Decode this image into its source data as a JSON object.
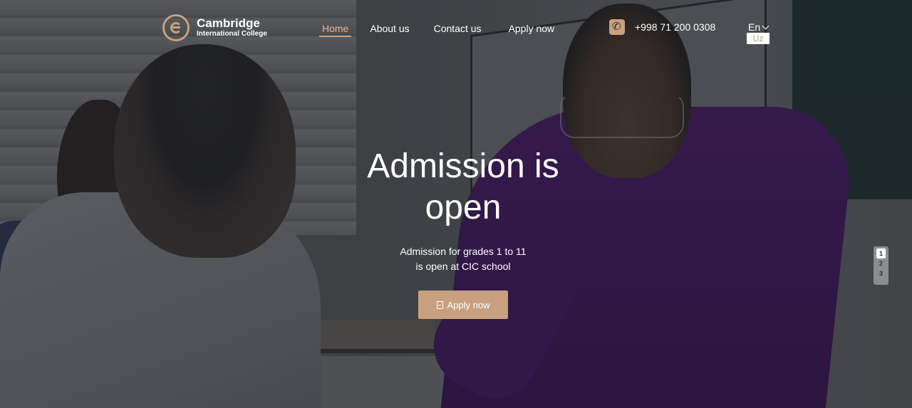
{
  "header": {
    "logo": {
      "title": "Cambridge",
      "subtitle": "International College"
    },
    "nav": [
      {
        "label": "Home",
        "active": true
      },
      {
        "label": "About us",
        "active": false
      },
      {
        "label": "Contact us",
        "active": false
      },
      {
        "label": "Apply now",
        "active": false
      }
    ],
    "phone": {
      "icon": "phone-icon",
      "number": "+998 71 200 0308"
    },
    "language": {
      "current": "En",
      "alternate": "Uz"
    }
  },
  "hero": {
    "title_line1": "Admission is",
    "title_line2": "open",
    "subtitle_line1": "Admission for grades 1 to 11",
    "subtitle_line2": "is open at CIC school",
    "cta_label": "Apply now",
    "cta_icon": "document-icon"
  },
  "pager": {
    "pages": [
      "1",
      "2",
      "3"
    ],
    "current": "1"
  },
  "colors": {
    "accent": "#c9a07f",
    "active_nav": "#e6b896",
    "text": "#ffffff"
  }
}
